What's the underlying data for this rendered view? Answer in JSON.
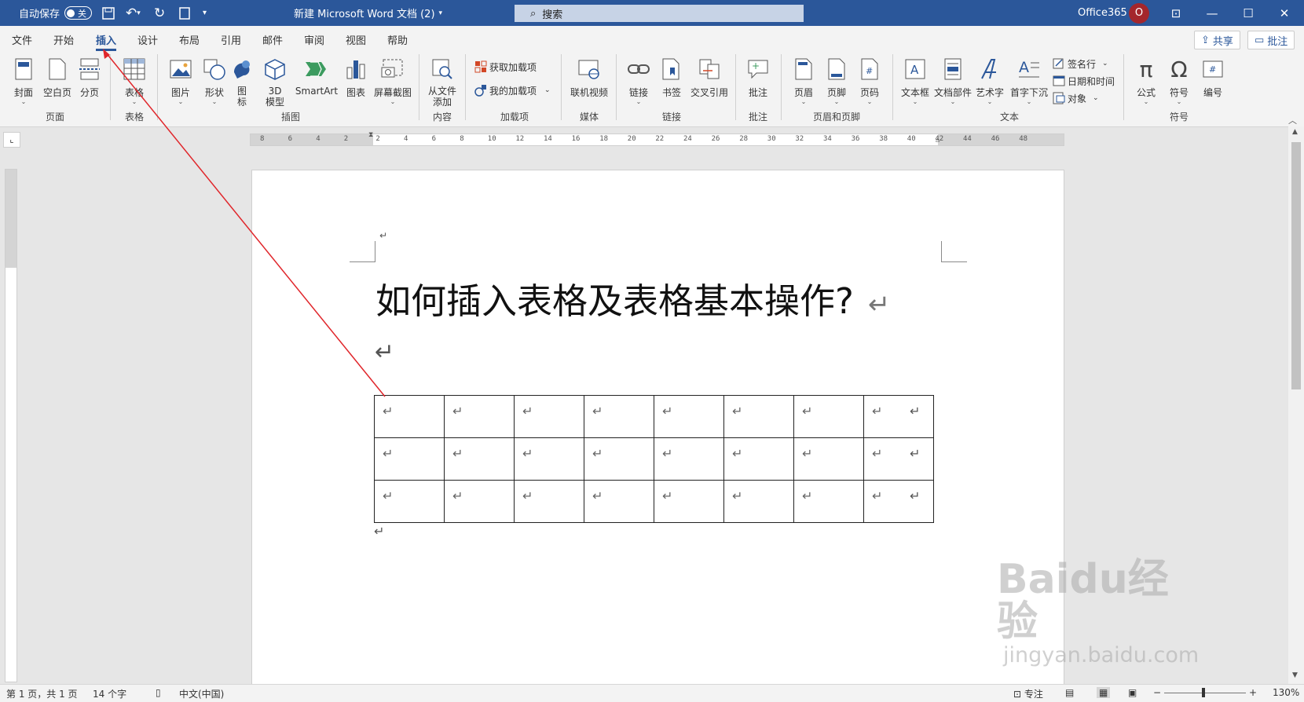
{
  "titlebar": {
    "autosave_label": "自动保存",
    "autosave_state": "关",
    "doc_title": "新建 Microsoft Word 文档 (2)",
    "search_placeholder": "搜索",
    "account": "Office365",
    "avatar_letter": "O"
  },
  "tabs": [
    "文件",
    "开始",
    "插入",
    "设计",
    "布局",
    "引用",
    "邮件",
    "审阅",
    "视图",
    "帮助"
  ],
  "share_label": "共享",
  "comment_label": "批注",
  "ribbon": {
    "page": {
      "cover": "封面",
      "blank": "空白页",
      "break": "分页",
      "group": "页面"
    },
    "table": {
      "table": "表格",
      "group": "表格"
    },
    "illus": {
      "picture": "图片",
      "shape": "形状",
      "icon": "图\n标",
      "model3d": "3D\n模型",
      "smartart": "SmartArt",
      "chart": "图表",
      "screenshot": "屏幕截图",
      "group": "插图"
    },
    "content": {
      "from_file": "从文件\n添加",
      "group": "内容"
    },
    "addins": {
      "get": "获取加载项",
      "my": "我的加载项",
      "group": "加载项"
    },
    "media": {
      "video": "联机视频",
      "group": "媒体"
    },
    "links": {
      "link": "链接",
      "bookmark": "书签",
      "xref": "交叉引用",
      "group": "链接"
    },
    "comments": {
      "comment": "批注",
      "group": "批注"
    },
    "hf": {
      "header": "页眉",
      "footer": "页脚",
      "pagenum": "页码",
      "group": "页眉和页脚"
    },
    "text": {
      "textbox": "文本框",
      "quickparts": "文档部件",
      "wordart": "艺术字",
      "dropcap": "首字下沉",
      "signature": "签名行",
      "datetime": "日期和时间",
      "object": "对象",
      "group": "文本"
    },
    "symbols": {
      "equation": "公式",
      "symbol": "符号",
      "number": "编号",
      "group": "符号"
    }
  },
  "ruler_numbers": [
    "8",
    "6",
    "4",
    "2",
    "2",
    "4",
    "6",
    "8",
    "10",
    "12",
    "14",
    "16",
    "18",
    "20",
    "22",
    "24",
    "26",
    "28",
    "30",
    "32",
    "34",
    "36",
    "38",
    "40",
    "42",
    "44",
    "46",
    "48"
  ],
  "document": {
    "heading": "如何插入表格及表格基本操作?",
    "para_mark": "↵",
    "table": {
      "rows": 3,
      "cols": 8
    }
  },
  "statusbar": {
    "page": "第 1 页，共 1 页",
    "words": "14 个字",
    "lang": "中文(中国)",
    "focus": "专注",
    "zoom": "130%"
  },
  "watermark": {
    "text": "Baidu经验",
    "url": "jingyan.baidu.com"
  }
}
